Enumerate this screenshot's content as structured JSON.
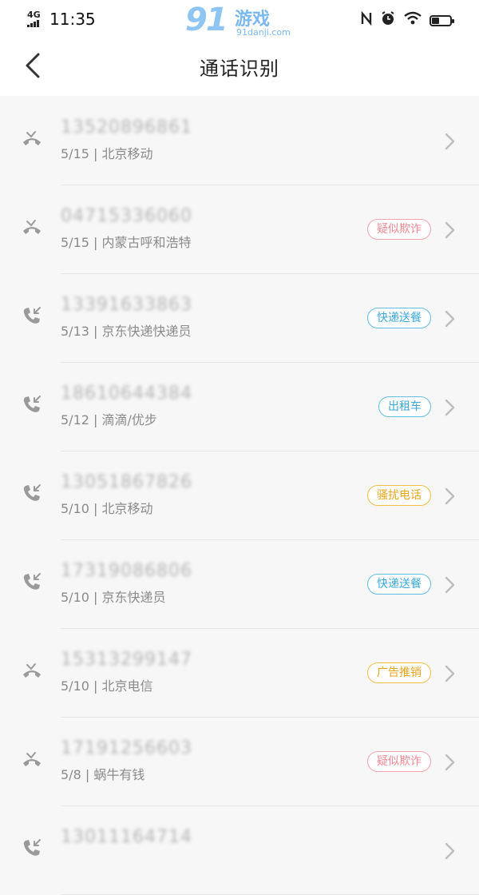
{
  "status_bar": {
    "network": "4G",
    "time": "11:35",
    "icons": [
      "nfc-icon",
      "alarm-icon",
      "wifi-icon",
      "battery-icon"
    ],
    "battery_level": 0.4
  },
  "watermark": {
    "logo": "91",
    "text": "游戏",
    "subtext": "91danji.com"
  },
  "header": {
    "title": "通话识别",
    "back_icon": "chevron-left-icon"
  },
  "colors": {
    "fraud": "#f08a93",
    "delivery": "#3aa8d8",
    "nuisance": "#e6a51c",
    "text_primary": "#222222",
    "text_secondary": "#8a8a8a"
  },
  "calls": [
    {
      "number": "13520896861",
      "date": "5/15",
      "location": "北京移动",
      "call_type": "missed",
      "tag": null
    },
    {
      "number": "04715336060",
      "date": "5/15",
      "location": "内蒙古呼和浩特",
      "call_type": "missed",
      "tag": "疑似欺诈",
      "tag_style": "fraud"
    },
    {
      "number": "13391633863",
      "date": "5/13",
      "location": "京东快递快递员",
      "call_type": "incoming",
      "tag": "快递送餐",
      "tag_style": "delivery"
    },
    {
      "number": "18610644384",
      "date": "5/12",
      "location": "滴滴/优步",
      "call_type": "incoming",
      "tag": "出租车",
      "tag_style": "delivery"
    },
    {
      "number": "13051867826",
      "date": "5/10",
      "location": "北京移动",
      "call_type": "incoming",
      "tag": "骚扰电话",
      "tag_style": "nuisance"
    },
    {
      "number": "17319086806",
      "date": "5/10",
      "location": "京东快递员",
      "call_type": "incoming",
      "tag": "快递送餐",
      "tag_style": "delivery"
    },
    {
      "number": "15313299147",
      "date": "5/10",
      "location": "北京电信",
      "call_type": "missed",
      "tag": "广告推销",
      "tag_style": "nuisance"
    },
    {
      "number": "17191256603",
      "date": "5/8",
      "location": "蜗牛有钱",
      "call_type": "missed",
      "tag": "疑似欺诈",
      "tag_style": "fraud"
    },
    {
      "number": "13011164714",
      "date": "",
      "location": "",
      "call_type": "incoming",
      "tag": null
    }
  ]
}
